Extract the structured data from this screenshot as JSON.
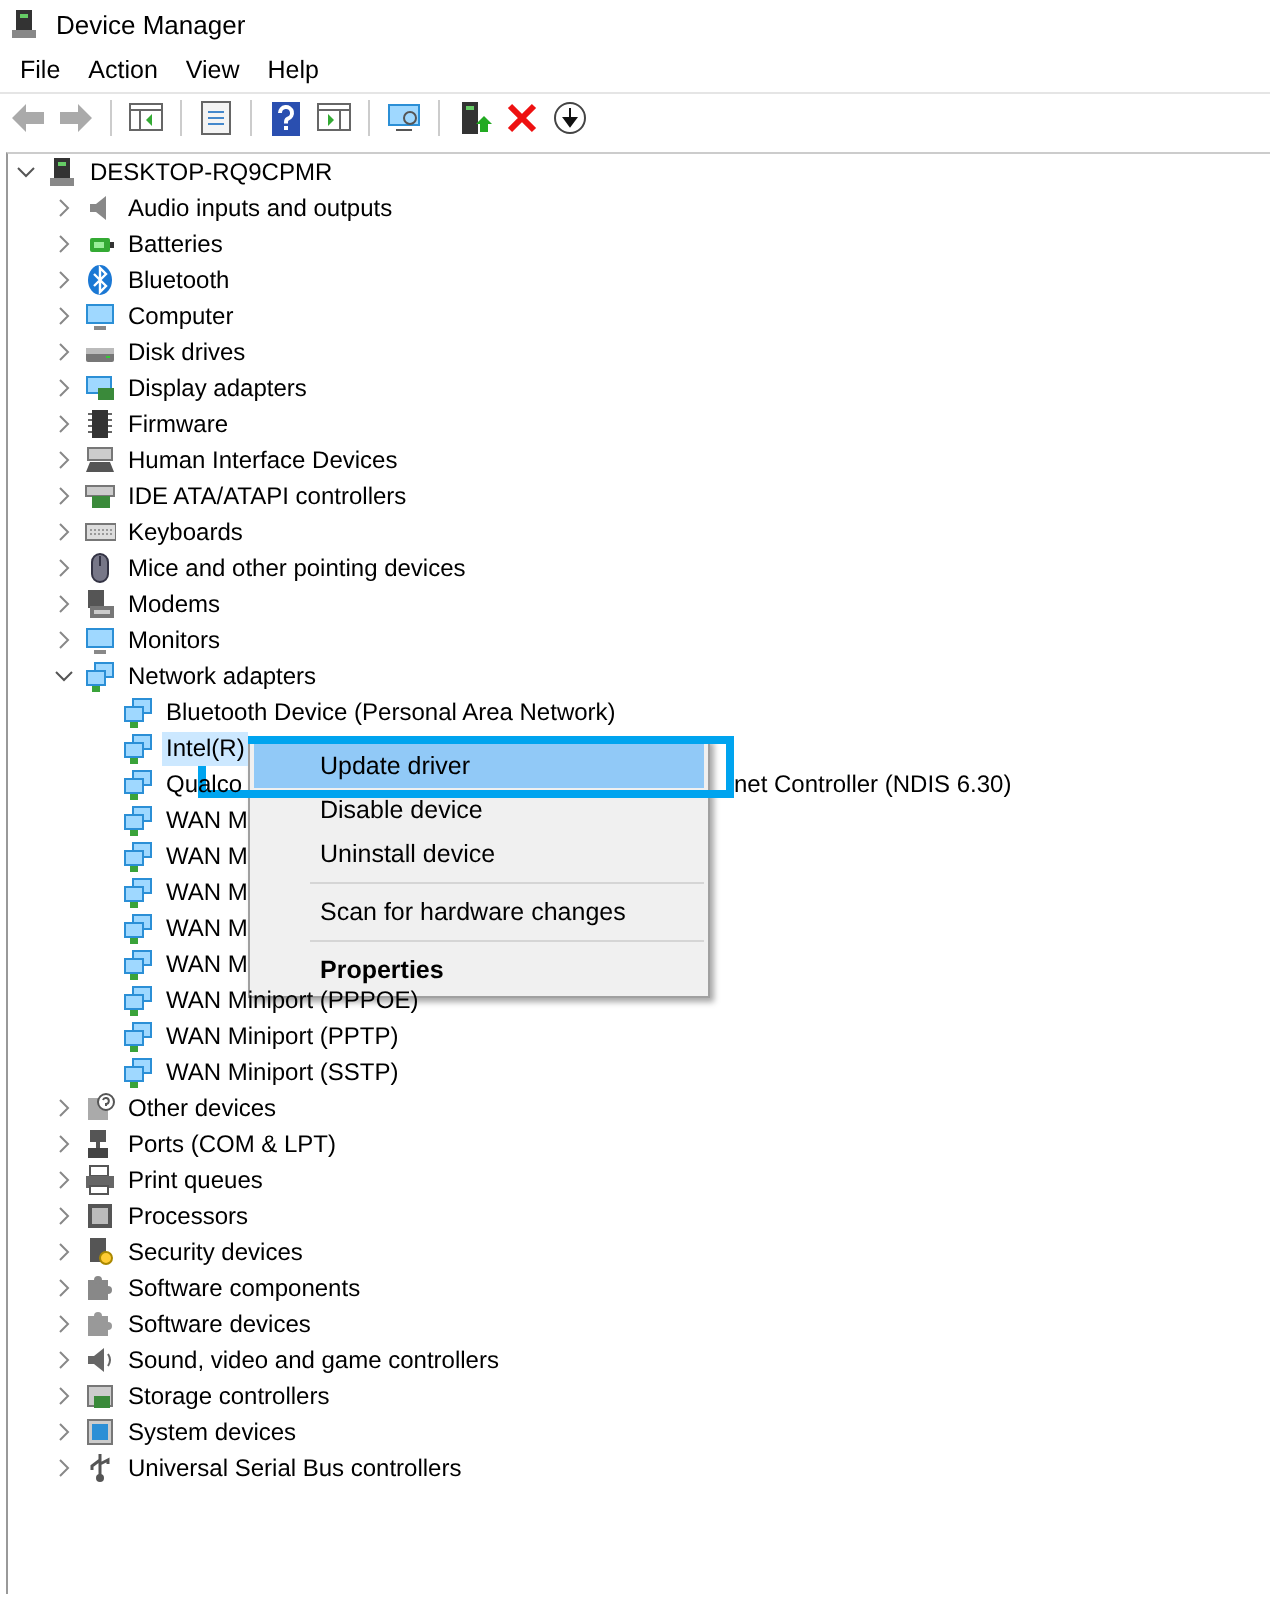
{
  "window": {
    "title": "Device Manager"
  },
  "menu_bar": [
    "File",
    "Action",
    "View",
    "Help"
  ],
  "tree": {
    "label": "DESKTOP-RQ9CPMR",
    "expanded": true,
    "selected": false,
    "children": [
      {
        "label": "Audio inputs and outputs",
        "expanded": false,
        "selected": false
      },
      {
        "label": "Batteries",
        "expanded": false,
        "selected": false
      },
      {
        "label": "Bluetooth",
        "expanded": false,
        "selected": false
      },
      {
        "label": "Computer",
        "expanded": false,
        "selected": false
      },
      {
        "label": "Disk drives",
        "expanded": false,
        "selected": false
      },
      {
        "label": "Display adapters",
        "expanded": false,
        "selected": false
      },
      {
        "label": "Firmware",
        "expanded": false,
        "selected": false
      },
      {
        "label": "Human Interface Devices",
        "expanded": false,
        "selected": false
      },
      {
        "label": "IDE ATA/ATAPI controllers",
        "expanded": false,
        "selected": false
      },
      {
        "label": "Keyboards",
        "expanded": false,
        "selected": false
      },
      {
        "label": "Mice and other pointing devices",
        "expanded": false,
        "selected": false
      },
      {
        "label": "Modems",
        "expanded": false,
        "selected": false
      },
      {
        "label": "Monitors",
        "expanded": false,
        "selected": false
      },
      {
        "label": "Network adapters",
        "expanded": true,
        "selected": false,
        "children": [
          {
            "label": "Bluetooth Device (Personal Area Network)",
            "selected": false
          },
          {
            "label": "Intel(R)",
            "selected": true
          },
          {
            "label": "Qualco",
            "label_tail": "net Controller (NDIS 6.30)",
            "selected": false
          },
          {
            "label": "WAN M",
            "selected": false
          },
          {
            "label": "WAN M",
            "selected": false
          },
          {
            "label": "WAN M",
            "selected": false
          },
          {
            "label": "WAN M",
            "selected": false
          },
          {
            "label": "WAN M",
            "selected": false
          },
          {
            "label": "WAN Miniport (PPPOE)",
            "selected": false
          },
          {
            "label": "WAN Miniport (PPTP)",
            "selected": false
          },
          {
            "label": "WAN Miniport (SSTP)",
            "selected": false
          }
        ]
      },
      {
        "label": "Other devices",
        "expanded": false,
        "selected": false
      },
      {
        "label": "Ports (COM & LPT)",
        "expanded": false,
        "selected": false
      },
      {
        "label": "Print queues",
        "expanded": false,
        "selected": false
      },
      {
        "label": "Processors",
        "expanded": false,
        "selected": false
      },
      {
        "label": "Security devices",
        "expanded": false,
        "selected": false
      },
      {
        "label": "Software components",
        "expanded": false,
        "selected": false
      },
      {
        "label": "Software devices",
        "expanded": false,
        "selected": false
      },
      {
        "label": "Sound, video and game controllers",
        "expanded": false,
        "selected": false
      },
      {
        "label": "Storage controllers",
        "expanded": false,
        "selected": false
      },
      {
        "label": "System devices",
        "expanded": false,
        "selected": false
      },
      {
        "label": "Universal Serial Bus controllers",
        "expanded": false,
        "selected": false
      }
    ]
  },
  "context_menu": {
    "items": [
      {
        "kind": "item",
        "label": "Update driver",
        "selected": true,
        "outlined": true
      },
      {
        "kind": "item",
        "label": "Disable device",
        "selected": false
      },
      {
        "kind": "item",
        "label": "Uninstall device",
        "selected": false
      },
      {
        "kind": "separator"
      },
      {
        "kind": "item",
        "label": "Scan for hardware changes",
        "selected": false
      },
      {
        "kind": "separator"
      },
      {
        "kind": "item",
        "label": "Properties",
        "selected": false,
        "default": true
      }
    ]
  }
}
